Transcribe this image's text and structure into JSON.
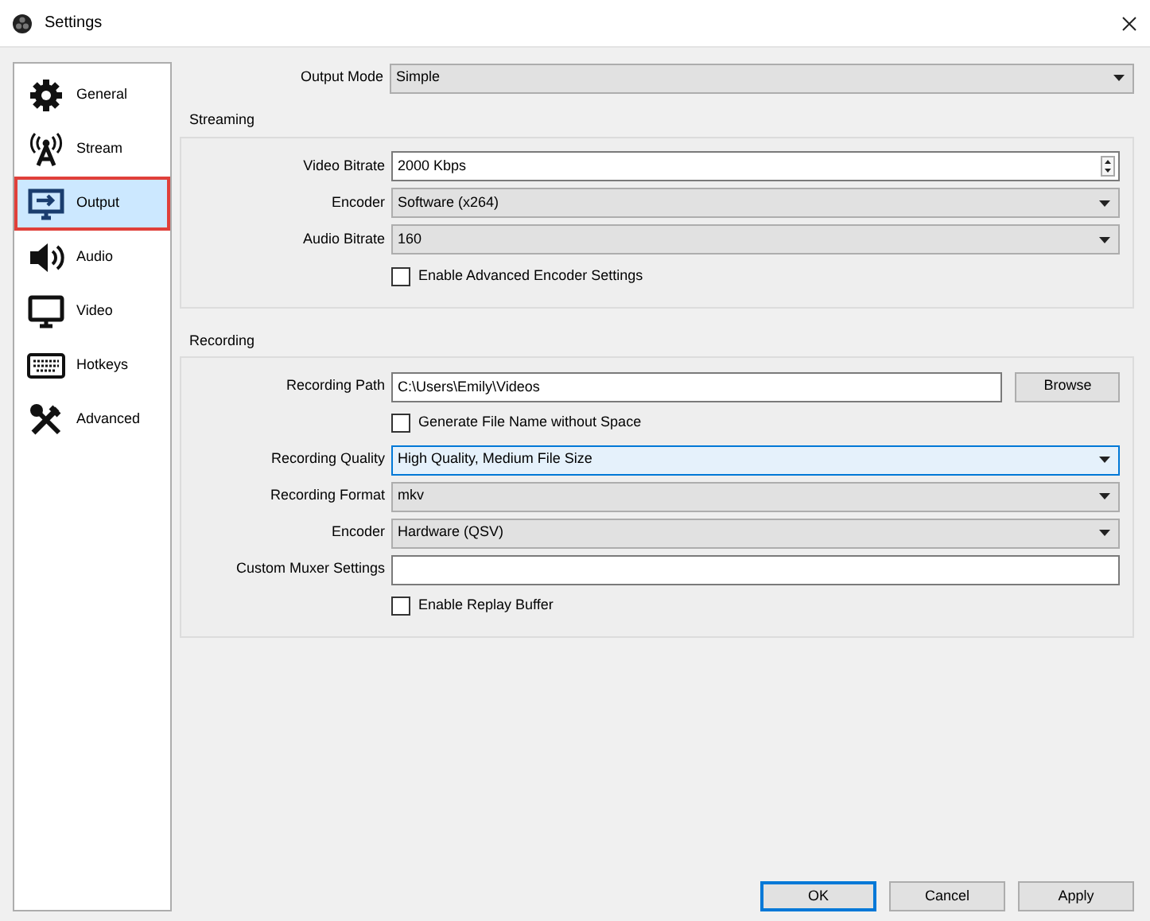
{
  "window": {
    "title": "Settings"
  },
  "sidebar": {
    "items": [
      {
        "kind": "gear",
        "label": "General",
        "selected": false
      },
      {
        "kind": "antenna",
        "label": "Stream",
        "selected": false
      },
      {
        "kind": "output",
        "label": "Output",
        "selected": true
      },
      {
        "kind": "speaker",
        "label": "Audio",
        "selected": false
      },
      {
        "kind": "monitor",
        "label": "Video",
        "selected": false
      },
      {
        "kind": "keyboard",
        "label": "Hotkeys",
        "selected": false
      },
      {
        "kind": "tools",
        "label": "Advanced",
        "selected": false
      }
    ]
  },
  "output_mode": {
    "label": "Output Mode",
    "value": "Simple"
  },
  "sections": [
    {
      "title": "Streaming",
      "rows": [
        {
          "kind": "spin",
          "label": "Video Bitrate",
          "value": "2000 Kbps"
        },
        {
          "kind": "select",
          "label": "Encoder",
          "value": "Software (x264)",
          "focused": false
        },
        {
          "kind": "select",
          "label": "Audio Bitrate",
          "value": "160",
          "focused": false
        },
        {
          "kind": "checkbox",
          "label": "Enable Advanced Encoder Settings",
          "checked": false
        }
      ]
    },
    {
      "title": "Recording",
      "rows": [
        {
          "kind": "path",
          "label": "Recording Path",
          "value": "C:\\Users\\Emily\\Videos",
          "button": "Browse"
        },
        {
          "kind": "checkbox",
          "label": "Generate File Name without Space",
          "checked": false
        },
        {
          "kind": "select",
          "label": "Recording Quality",
          "value": "High Quality, Medium File Size",
          "focused": true
        },
        {
          "kind": "select",
          "label": "Recording Format",
          "value": "mkv",
          "focused": false
        },
        {
          "kind": "select",
          "label": "Encoder",
          "value": "Hardware (QSV)",
          "focused": false
        },
        {
          "kind": "text",
          "label": "Custom Muxer Settings"
        },
        {
          "kind": "checkbox",
          "label": "Enable Replay Buffer",
          "checked": false
        }
      ]
    }
  ],
  "buttons": [
    {
      "label": "OK",
      "default": true
    },
    {
      "label": "Cancel",
      "default": false
    },
    {
      "label": "Apply",
      "default": false
    }
  ]
}
